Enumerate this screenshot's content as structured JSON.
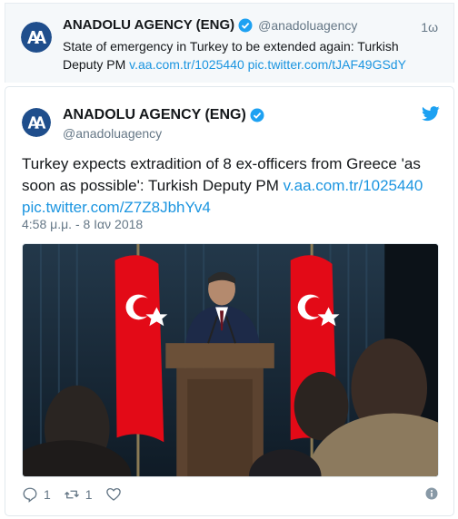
{
  "reply_tweet": {
    "author_name": "ANADOLU AGENCY (ENG)",
    "handle": "@anadoluagency",
    "time": "1ω",
    "text": "State of emergency in Turkey to be extended again: Turkish Deputy PM ",
    "link1": "v.aa.com.tr/1025440",
    "link2": "pic.twitter.com/tJAF49GSdY"
  },
  "main_tweet": {
    "author_name": "ANADOLU AGENCY (ENG)",
    "handle": "@anadoluagency",
    "text": "Turkey expects extradition of 8 ex-officers from Greece 'as soon as possible': Turkish Deputy PM ",
    "link1": "v.aa.com.tr/1025440",
    "link2": "pic.twitter.com/Z7Z8JbhYv4",
    "timestamp": "4:58 μ.μ. - 8 Ιαν 2018",
    "reply_count": "1",
    "retweet_count": "1"
  },
  "icons": {
    "avatar": "aa-logo-icon",
    "verified": "verified-badge-icon",
    "brand": "twitter-bird-icon",
    "reply": "reply-icon",
    "retweet": "retweet-icon",
    "like": "heart-icon",
    "info": "info-icon"
  },
  "colors": {
    "link": "#1b95e0",
    "verified": "#1da1f2",
    "muted": "#657786",
    "text": "#14171a",
    "logo_blue": "#1f4e8c",
    "flag_red": "#e30a17"
  }
}
